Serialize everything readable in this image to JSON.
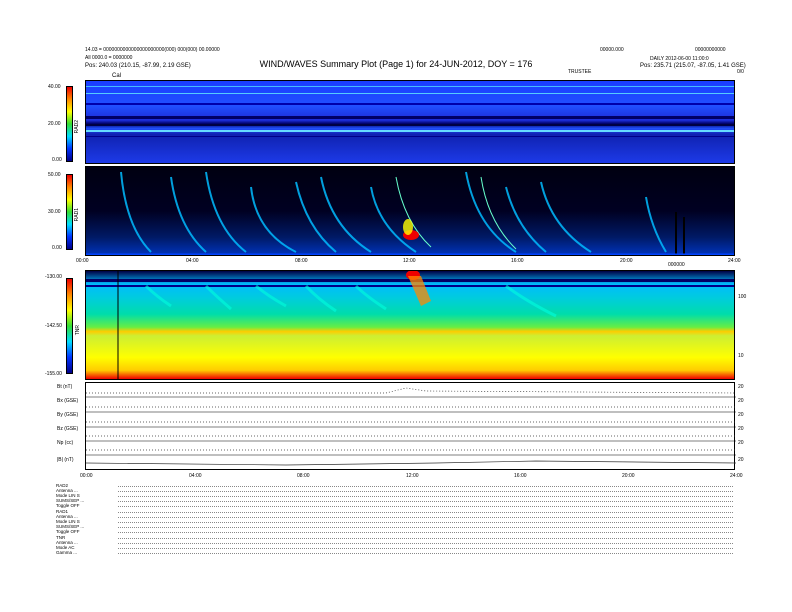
{
  "title": "WIND/WAVES Summary Plot (Page 1) for 24-JUN-2012, DOY = 176",
  "header": {
    "line1": "14.03 = 0000000000000000000000(000) 000(000) 00.00000",
    "line2": "All 0000.0 = 0000000",
    "line3": "Pos: 240.03 (210.15, -87.99, 2.19 GSE)",
    "right1": "00000.000",
    "right2": "00000000000",
    "right3": "DAILY 2012-06-00 11:00:0",
    "right4": "Pos: 235.71 (215.07, -87.05, 1.41 GSE)",
    "tr_small": "TRUSTEE",
    "cal_label": "Cal",
    "corner": "0/0"
  },
  "panels": {
    "rad2": {
      "label": "RAD2",
      "ticks": [
        "40.00",
        "20.00",
        "0.00"
      ]
    },
    "rad1": {
      "label": "RAD1",
      "ticks": [
        "50.00",
        "30.00",
        "0.00"
      ]
    },
    "tnr": {
      "label": "TNR",
      "ticks": [
        "-130.00",
        "-142.50",
        "-155.00"
      ],
      "right_ticks": [
        "100",
        "10"
      ],
      "top_right": "000000"
    },
    "time_ticks": [
      "00:00",
      "04:00",
      "08:00",
      "12:00",
      "16:00",
      "20:00",
      "24:00"
    ]
  },
  "mag_rows": [
    {
      "label": "Bt (nT)",
      "r1": "20",
      "r2": "0"
    },
    {
      "label": "Bx (GSE)",
      "r1": "20",
      "r2": "0"
    },
    {
      "label": "By (GSE)",
      "r1": "20",
      "r2": "0"
    },
    {
      "label": "Bz (GSE)",
      "r1": "20",
      "r2": "0"
    },
    {
      "label": "Np (cc)",
      "r1": "20",
      "r2": "0"
    },
    {
      "label": "|B| (nT)",
      "r1": "20",
      "r2": "0"
    }
  ],
  "bottom_labels": {
    "rad2": "RAD2",
    "rad2_lines": [
      "Antenna  ...",
      "Mode     LIN  S",
      "SUMS/SEP  ...",
      "Toggle   OFF"
    ],
    "rad1": "RAD1",
    "rad1_lines": [
      "Antenna  ...",
      "Mode     LIN  S",
      "SUMS/SEP  ...",
      "Toggle   OFF"
    ],
    "tnr": "TNR",
    "tnr_lines": [
      "Antenna  ...",
      "Mode     AC",
      "Gamma    ..."
    ]
  },
  "colors": {
    "deep": "#000088",
    "blue": "#0033ff",
    "cyan": "#00ddff",
    "green": "#33dd33",
    "yellow": "#ffff00",
    "red": "#ee0000",
    "black": "#000000"
  },
  "chart_data": {
    "type": "heatmap",
    "title": "WIND/WAVES Summary Plot (Page 1) for 24-JUN-2012, DOY = 176",
    "xlabel": "",
    "x_ticks": [
      "00:00",
      "04:00",
      "08:00",
      "12:00",
      "16:00",
      "20:00",
      "24:00"
    ],
    "xlim": [
      "00:00",
      "24:00"
    ],
    "panels": [
      {
        "name": "RAD2",
        "ylim": [
          0,
          40
        ],
        "ticks": [
          40,
          20,
          0
        ]
      },
      {
        "name": "RAD1",
        "ylim": [
          0,
          50
        ],
        "ticks": [
          50,
          30,
          0
        ]
      },
      {
        "name": "TNR",
        "ylim": [
          -155,
          -130
        ],
        "ticks": [
          -130,
          -142.5,
          -155
        ]
      }
    ],
    "events": [
      {
        "time": "11:45",
        "panel": "RAD1",
        "intensity": "high"
      },
      {
        "time": "12:00",
        "panel": "TNR",
        "intensity": "high"
      }
    ]
  }
}
